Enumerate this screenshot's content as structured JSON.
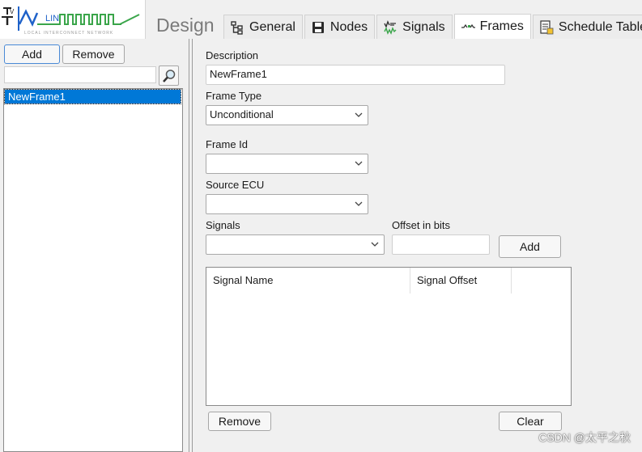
{
  "header": {
    "logo_tagline": "LOCAL INTERCONNECT NETWORK",
    "logo_lin": "LIN",
    "logo_v": "V",
    "design_label": "Design",
    "tabs": [
      {
        "label": "General",
        "icon": "tree-icon"
      },
      {
        "label": "Nodes",
        "icon": "save-disk-icon"
      },
      {
        "label": "Signals",
        "icon": "signals-icon"
      },
      {
        "label": "Frames",
        "icon": "frames-icon",
        "active": true
      },
      {
        "label": "Schedule Table",
        "icon": "schedule-table-icon"
      }
    ]
  },
  "left": {
    "add_label": "Add",
    "remove_label": "Remove",
    "search_value": "",
    "frames": [
      "NewFrame1"
    ],
    "selected_index": 0
  },
  "form": {
    "description_label": "Description",
    "description_value": "NewFrame1",
    "frame_type_label": "Frame Type",
    "frame_type_value": "Unconditional",
    "frame_id_label": "Frame Id",
    "frame_id_value": "",
    "source_ecu_label": "Source ECU",
    "source_ecu_value": "",
    "signals_label": "Signals",
    "signals_value": "",
    "offset_label": "Offset in bits",
    "offset_value": "",
    "add_label": "Add",
    "table": {
      "columns": [
        "Signal Name",
        "Signal Offset"
      ],
      "rows": []
    },
    "remove_label": "Remove",
    "clear_label": "Clear"
  },
  "watermark": "CSDN @太平之秋",
  "colors": {
    "selection": "#0078d7",
    "logo_green": "#3aa54a",
    "logo_blue": "#1f62c9",
    "logo_orange": "#e0843a"
  }
}
